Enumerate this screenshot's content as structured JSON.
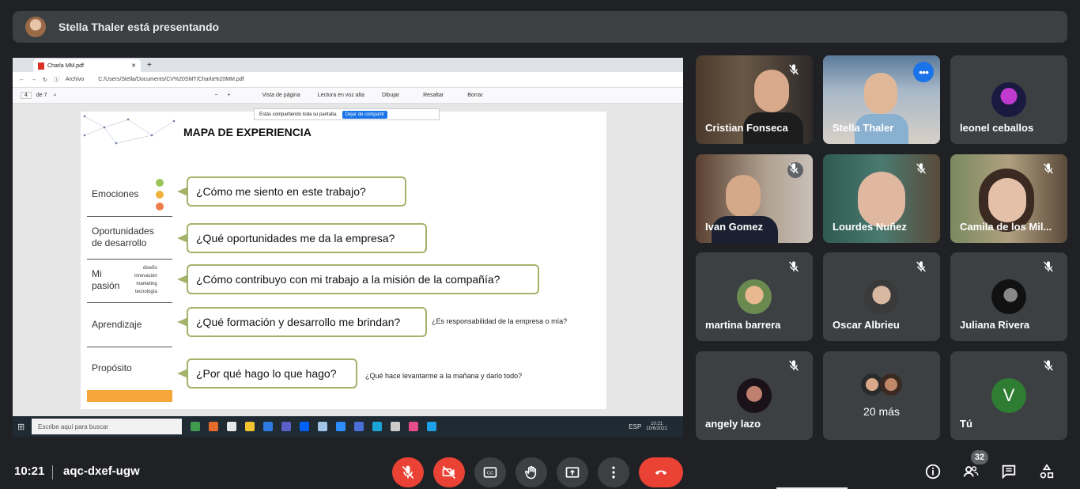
{
  "banner": {
    "presenting_text": "Stella Thaler está presentando"
  },
  "browser": {
    "tab_title": "Charla MM.pdf",
    "address_prefix": "Archivo",
    "address": "C:/Users/Stella/Documents/CV%20SMT/Charla%20MM.pdf",
    "page_current": "4",
    "page_total": "de 7",
    "toolbar": {
      "page_view": "Vista de página",
      "read_aloud": "Lectura en voz alta",
      "draw": "Dibujar",
      "highlight": "Resaltar",
      "erase": "Borrar"
    },
    "share_notice": "Estás compartiendo toda su pantalla.",
    "share_stop": "Dejar de compartir"
  },
  "slide": {
    "title": "MAPA DE EXPERIENCIA",
    "rows": [
      {
        "label": "Emociones",
        "question": "¿Cómo me siento en este trabajo?"
      },
      {
        "label": "Oportunidades\nde desarrollo",
        "question": "¿Qué oportunidades me da la empresa?"
      },
      {
        "label": "Mi\npasión",
        "question": "¿Cómo contribuyo con mi trabajo a la misión de la compañía?"
      },
      {
        "label": "Aprendizaje",
        "question": "¿Qué formación y desarrollo me brindan?"
      },
      {
        "label": "Propósito",
        "question": "¿Por qué hago lo que hago?"
      }
    ],
    "passion_tags": [
      "diseño",
      "innovación",
      "marketing",
      "tecnología"
    ],
    "note_learning": "¿Es responsabilidad de la empresa o mía?",
    "note_purpose": "¿Qué hace levantarme a la mañana y darlo todo?"
  },
  "taskbar": {
    "search_placeholder": "Escribe aquí para buscar",
    "lang": "ESP",
    "time": "10:21",
    "date": "10/6/2021"
  },
  "participants": [
    {
      "name": "Cristian Fonseca",
      "muted": true,
      "video": true
    },
    {
      "name": "Stella Thaler",
      "muted": false,
      "video": true,
      "speaking": true
    },
    {
      "name": "leonel ceballos",
      "muted": false,
      "video": false
    },
    {
      "name": "Ivan Gomez",
      "muted": true,
      "video": true
    },
    {
      "name": "Lourdes Nuñez",
      "muted": true,
      "video": true
    },
    {
      "name": "Camila de los Mil...",
      "muted": true,
      "video": true
    },
    {
      "name": "martina barrera",
      "muted": true,
      "video": false
    },
    {
      "name": "Oscar Albrieu",
      "muted": true,
      "video": false
    },
    {
      "name": "Juliana Rivera",
      "muted": true,
      "video": false
    },
    {
      "name": "angely lazo",
      "muted": true,
      "video": false
    },
    {
      "name": "20 más",
      "muted": false,
      "video": false
    },
    {
      "name": "Tú",
      "muted": true,
      "video": false,
      "initial": "V"
    }
  ],
  "meeting": {
    "time": "10:21",
    "code": "aqc-dxef-ugw",
    "participant_count": "32"
  },
  "colors": {
    "accent_blue": "#1a73e8",
    "end_red": "#ea4335",
    "tile_bg": "#3c4043",
    "page_bg": "#202124",
    "bubble_border": "#a3b36a"
  }
}
